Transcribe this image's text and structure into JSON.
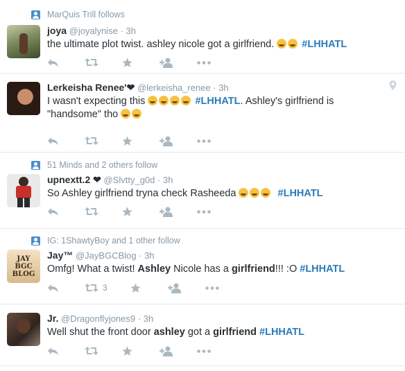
{
  "tweets": [
    {
      "context": "MarQuis Trill follows",
      "name": "joya",
      "handle": "@joyalynise",
      "dot": "·",
      "time": "3h",
      "body_pre": "the ultimate plot twist. ashley nicole got a girlfriend. ",
      "hashtag": "#LHHATL"
    },
    {
      "name": "Lerkeisha Renee'❤",
      "handle": "@lerkeisha_renee",
      "dot": "·",
      "time": "3h",
      "body_pre": "I wasn't expecting this ",
      "hashtag": "#LHHATL",
      "body_post": ". Ashley's girlfriend is \"handsome\" tho "
    },
    {
      "context": "51 Minds and 2 others follow",
      "name": "upnextt.2 ❤",
      "handle": "@Slvtty_g0d",
      "dot": "·",
      "time": "3h",
      "body_pre": "So Ashley girlfriend tryna check Rasheeda ",
      "hashtag": "#LHHATL"
    },
    {
      "context": "IG: 1ShawtyBoy and 1 other follow",
      "name": "Jay™",
      "handle": "@JayBGCBlog",
      "dot": "·",
      "time": "3h",
      "body_a": "Omfg! What a twist! ",
      "bold1": "Ashley",
      "body_b": " Nicole has a ",
      "bold2": "girlfriend",
      "body_c": "!!! :O ",
      "hashtag": "#LHHATL",
      "retweet_count": "3",
      "avatar_text": "JAY BGC BLOG"
    },
    {
      "name": "Jr.",
      "handle": "@Dragonflyjones9",
      "dot": "·",
      "time": "3h",
      "body_a": "Well shut the front door ",
      "bold1": "ashley",
      "body_b": " got a ",
      "bold2": "girlfriend",
      "body_c": " ",
      "hashtag": "#LHHATL"
    }
  ],
  "icons": {
    "context": "person-icon",
    "reply": "reply-icon",
    "retweet": "retweet-icon",
    "favorite": "star-icon",
    "follow": "add-person-icon",
    "more": "more-icon",
    "location": "location-pin-icon"
  },
  "colors": {
    "hashtag": "#2b7bb9",
    "muted": "#8899a6",
    "action": "#aab8c2",
    "divider": "#e1e8ed"
  }
}
